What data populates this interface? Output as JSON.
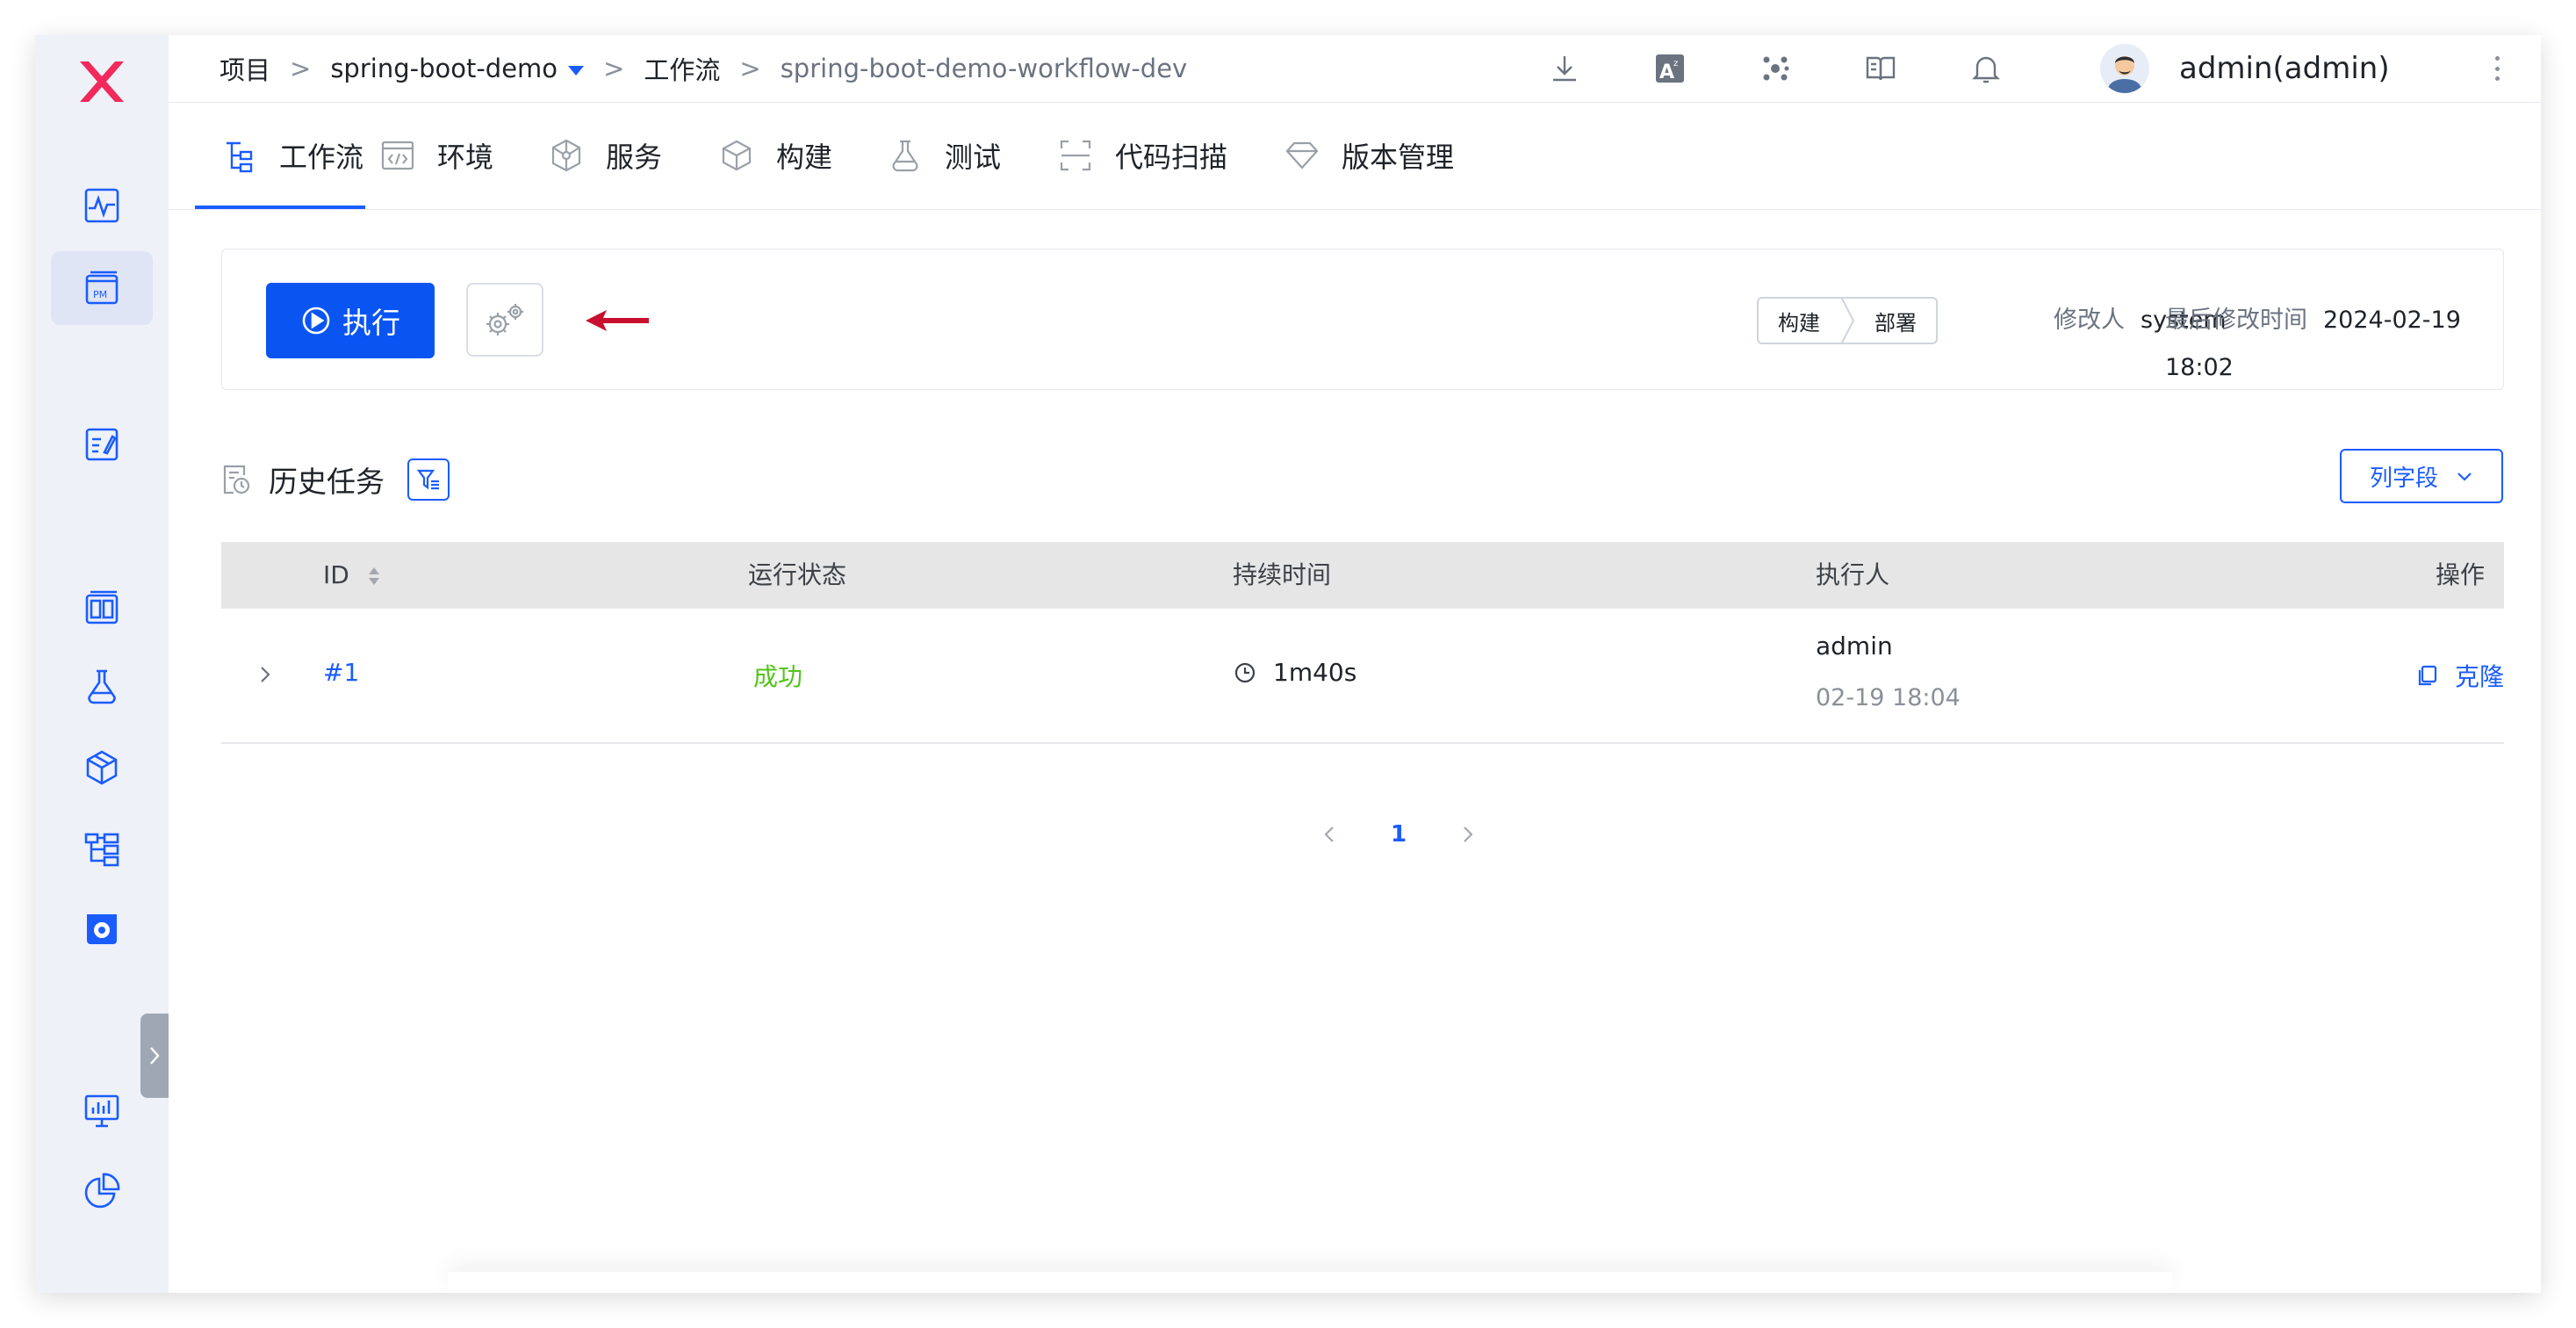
{
  "breadcrumb": {
    "items": [
      "项目",
      "spring-boot-demo",
      "工作流",
      "spring-boot-demo-workflow-dev"
    ],
    "separator": ">"
  },
  "user": {
    "name": "admin(admin)"
  },
  "icons": {
    "logo": "zadig-x-logo",
    "sidebar": [
      "pulse-icon",
      "pm-icon",
      "edit-icon",
      "dashboard-icon",
      "flask-icon",
      "package-icon",
      "tree-icon",
      "settings-icon",
      "monitor-icon",
      "pie-chart-icon"
    ],
    "topbar": [
      "download-icon",
      "translate-icon",
      "cluster-icon",
      "book-icon",
      "bell-icon"
    ]
  },
  "tabs": [
    {
      "label": "工作流",
      "icon": "workflow-icon",
      "active": true
    },
    {
      "label": "环境",
      "icon": "code-icon"
    },
    {
      "label": "服务",
      "icon": "cube-network-icon"
    },
    {
      "label": "构建",
      "icon": "box-icon"
    },
    {
      "label": "测试",
      "icon": "flask-icon"
    },
    {
      "label": "代码扫描",
      "icon": "scan-icon"
    },
    {
      "label": "版本管理",
      "icon": "diamond-icon"
    }
  ],
  "toolbar": {
    "run_label": "执行",
    "stages": [
      "构建",
      "部署"
    ],
    "modifier_label": "修改人",
    "modifier_value": "system",
    "modified_time_label": "最后修改时间",
    "modified_time_value": "2024-02-19 18:02"
  },
  "history": {
    "title": "历史任务",
    "columns_button": "列字段",
    "headers": [
      "ID",
      "运行状态",
      "持续时间",
      "执行人",
      "操作"
    ],
    "rows": [
      {
        "id": "#1",
        "status": "成功",
        "duration": "1m40s",
        "executor": "admin",
        "executor_time": "02-19 18:04",
        "action": "克隆"
      }
    ]
  },
  "pagination": {
    "current": "1"
  },
  "colors": {
    "primary": "#1a5cff",
    "button": "#0a55f2",
    "success": "#52c41a",
    "logo": "#f2295b",
    "sidebar_bg": "#eef1f8",
    "arrow": "#c8102e"
  }
}
